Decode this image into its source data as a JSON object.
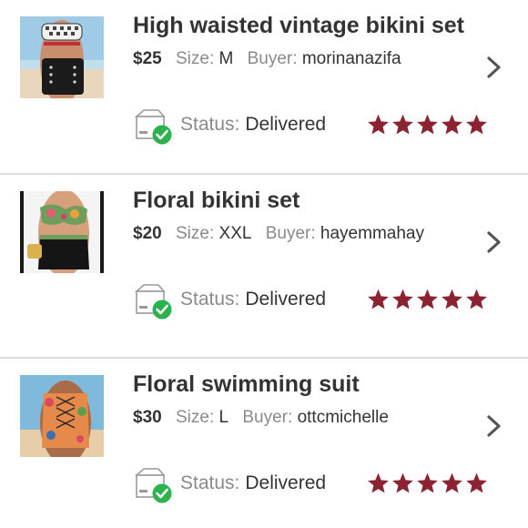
{
  "listings": [
    {
      "title": "High waisted vintage bikini set",
      "price": "$25",
      "size_label": "Size:",
      "size": "M",
      "buyer_label": "Buyer:",
      "buyer": "morinanazifa",
      "status_label": "Status:",
      "status": "Delivered",
      "rating": 5
    },
    {
      "title": "Floral bikini set",
      "price": "$20",
      "size_label": "Size:",
      "size": "XXL",
      "buyer_label": "Buyer:",
      "buyer": "hayemmahay",
      "status_label": "Status:",
      "status": "Delivered",
      "rating": 5
    },
    {
      "title": "Floral swimming suit",
      "price": "$30",
      "size_label": "Size:",
      "size": "L",
      "buyer_label": "Buyer:",
      "buyer": "ottcmichelle",
      "status_label": "Status:",
      "status": "Delivered",
      "rating": 5
    }
  ],
  "icons": {
    "chevron": "chevron-right-icon",
    "status": "delivered-box-icon",
    "star": "star-icon"
  },
  "colors": {
    "star": "#8b2332",
    "check": "#2bb24c",
    "label": "#8a8a8a",
    "text": "#333333",
    "divider": "#dedede"
  }
}
